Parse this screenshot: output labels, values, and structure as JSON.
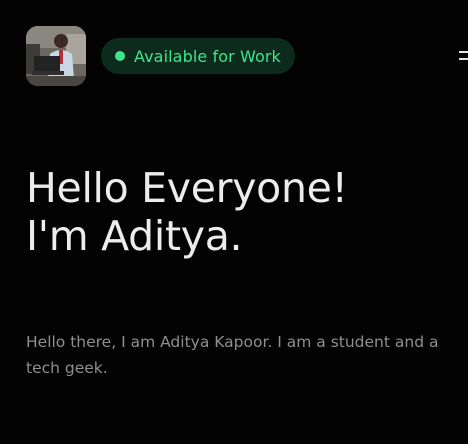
{
  "header": {
    "avatar_icon": "profile-photo",
    "status_badge": {
      "label": "Available for Work",
      "dot_color": "#3ee58d",
      "bg_color": "#0d2b1c"
    },
    "menu_icon": "hamburger-menu-icon"
  },
  "hero": {
    "headline_line1": "Hello Everyone!",
    "headline_line2": "I'm Aditya.",
    "intro": "Hello there, I am Aditya Kapoor. I am a student and a tech geek."
  }
}
